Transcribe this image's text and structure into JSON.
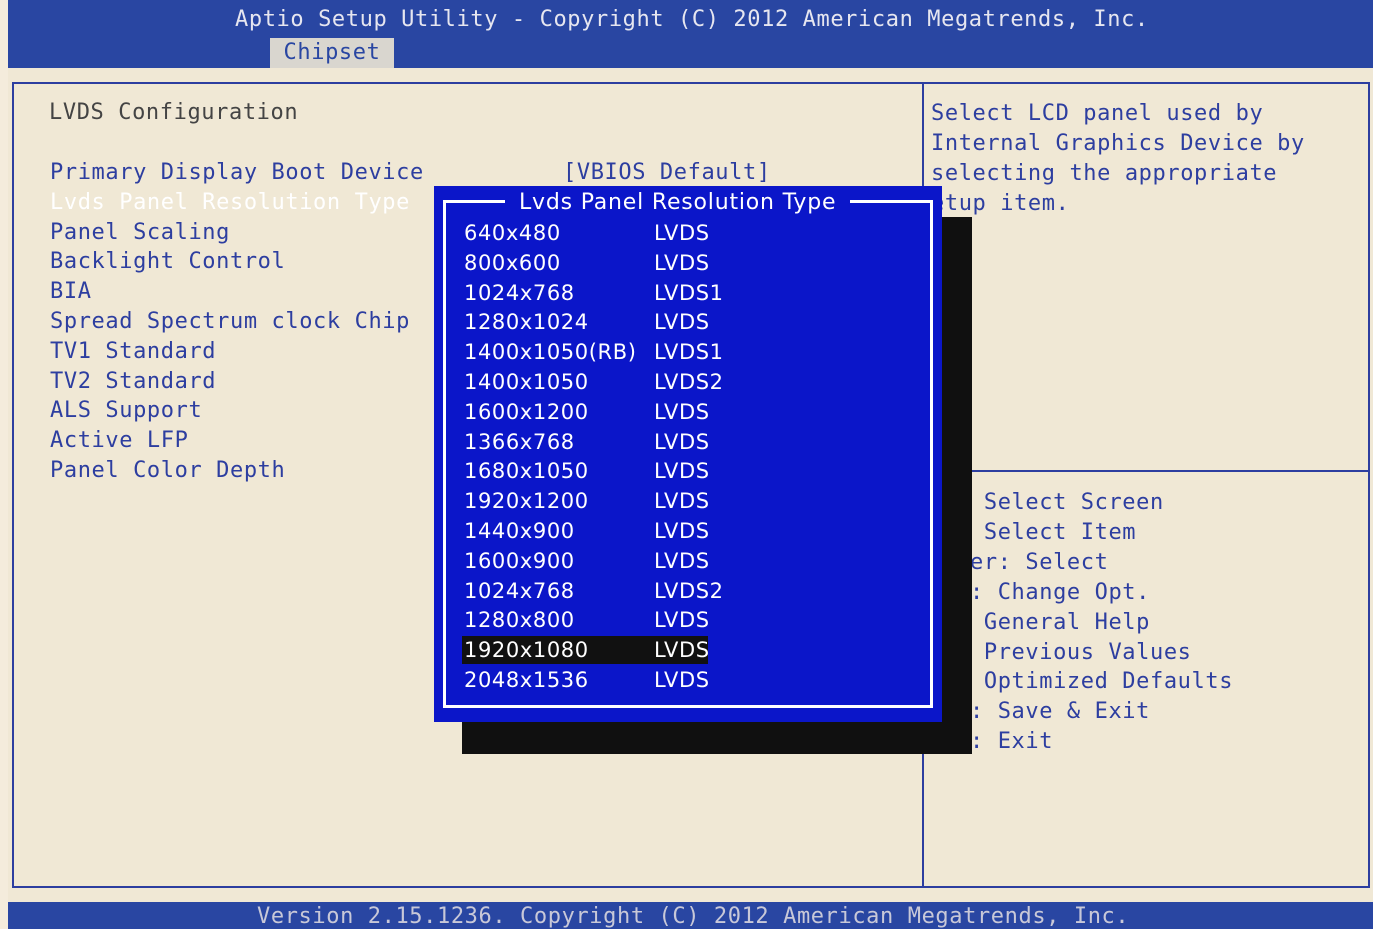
{
  "header": {
    "title": "Aptio Setup Utility - Copyright (C) 2012 American Megatrends, Inc.",
    "tabs": [
      {
        "label": "Chipset",
        "active": true
      }
    ]
  },
  "left": {
    "section_title": "LVDS Configuration",
    "settings": [
      {
        "label": "Primary Display Boot Device",
        "value": "[VBIOS Default]"
      },
      {
        "label": "Lvds Panel Resolution Type",
        "selected": true
      },
      {
        "label": "Panel Scaling"
      },
      {
        "label": "Backlight Control"
      },
      {
        "label": "BIA"
      },
      {
        "label": "Spread Spectrum clock Chip"
      },
      {
        "label": "TV1 Standard"
      },
      {
        "label": "TV2 Standard"
      },
      {
        "label": "ALS Support"
      },
      {
        "label": "Active LFP"
      },
      {
        "label": "Panel Color Depth"
      }
    ]
  },
  "help": {
    "lines": [
      "Select LCD panel used by",
      "Internal Graphics Device by",
      "selecting the appropriate",
      "etup item."
    ]
  },
  "keys": {
    "lines": [
      " Select Screen",
      " Select Item",
      "er: Select",
      ": Change Opt.",
      " General Help",
      " Previous Values",
      " Optimized Defaults",
      ": Save & Exit",
      ": Exit"
    ]
  },
  "popup": {
    "title": "Lvds Panel Resolution Type",
    "options": [
      {
        "res": "640x480",
        "type": "LVDS"
      },
      {
        "res": "800x600",
        "type": "LVDS"
      },
      {
        "res": "1024x768",
        "type": "LVDS1"
      },
      {
        "res": "1280x1024",
        "type": "LVDS"
      },
      {
        "res": "1400x1050(RB)",
        "type": "LVDS1"
      },
      {
        "res": "1400x1050",
        "type": "LVDS2"
      },
      {
        "res": "1600x1200",
        "type": "LVDS"
      },
      {
        "res": "1366x768",
        "type": "LVDS"
      },
      {
        "res": "1680x1050",
        "type": "LVDS"
      },
      {
        "res": "1920x1200",
        "type": "LVDS"
      },
      {
        "res": "1440x900",
        "type": "LVDS"
      },
      {
        "res": "1600x900",
        "type": "LVDS"
      },
      {
        "res": "1024x768",
        "type": "LVDS2"
      },
      {
        "res": "1280x800",
        "type": "LVDS"
      },
      {
        "res": "1920x1080",
        "type": "LVDS",
        "selected": true
      },
      {
        "res": "2048x1536",
        "type": "LVDS"
      }
    ]
  },
  "footer": {
    "text": "Version 2.15.1236. Copyright (C) 2012 American Megatrends, Inc."
  },
  "colors": {
    "header_bg": "#2946a2",
    "page_bg": "#f0e8d5",
    "text_blue": "#2d3ea0",
    "popup_bg": "#0b16c9",
    "popup_highlight": "#111111"
  }
}
